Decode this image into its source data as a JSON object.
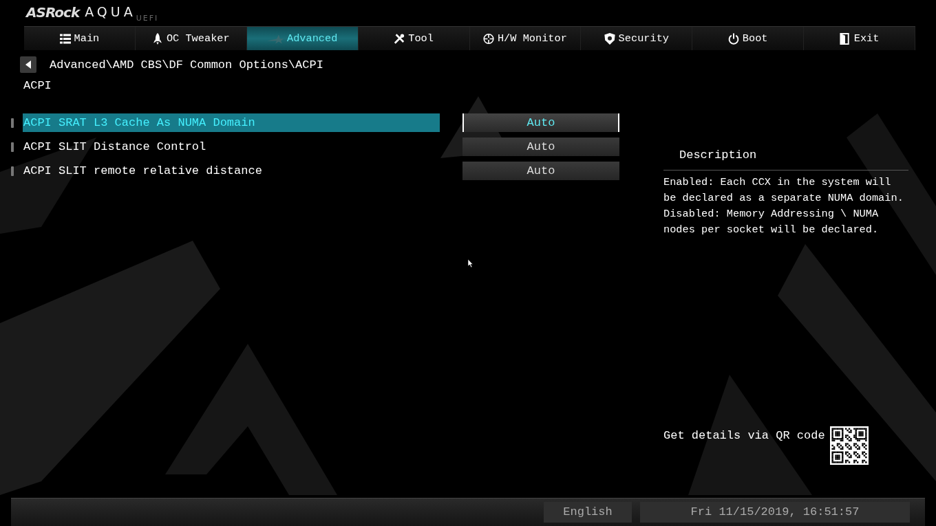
{
  "logo": {
    "brand": "ASRock",
    "product": "AQUA",
    "sub": "UEFI"
  },
  "tabs": [
    {
      "label": "Main",
      "selected": false
    },
    {
      "label": "OC Tweaker",
      "selected": false
    },
    {
      "label": "Advanced",
      "selected": true
    },
    {
      "label": "Tool",
      "selected": false
    },
    {
      "label": "H/W Monitor",
      "selected": false
    },
    {
      "label": "Security",
      "selected": false
    },
    {
      "label": "Boot",
      "selected": false
    },
    {
      "label": "Exit",
      "selected": false
    }
  ],
  "breadcrumb": "Advanced\\AMD CBS\\DF Common Options\\ACPI",
  "page_title": "ACPI",
  "settings": [
    {
      "label": "ACPI SRAT L3 Cache As NUMA Domain",
      "value": "Auto",
      "selected": true
    },
    {
      "label": "ACPI SLIT Distance Control",
      "value": "Auto",
      "selected": false
    },
    {
      "label": "ACPI SLIT remote relative distance",
      "value": "Auto",
      "selected": false
    }
  ],
  "description": {
    "heading": "Description",
    "text": "Enabled: Each CCX in the system will be declared as a separate NUMA domain. Disabled: Memory Addressing \\ NUMA nodes per socket will be declared."
  },
  "qr": {
    "label": "Get details via QR code"
  },
  "status_bar": {
    "language": "English",
    "datetime": "Fri 11/15/2019, 16:51:57"
  }
}
